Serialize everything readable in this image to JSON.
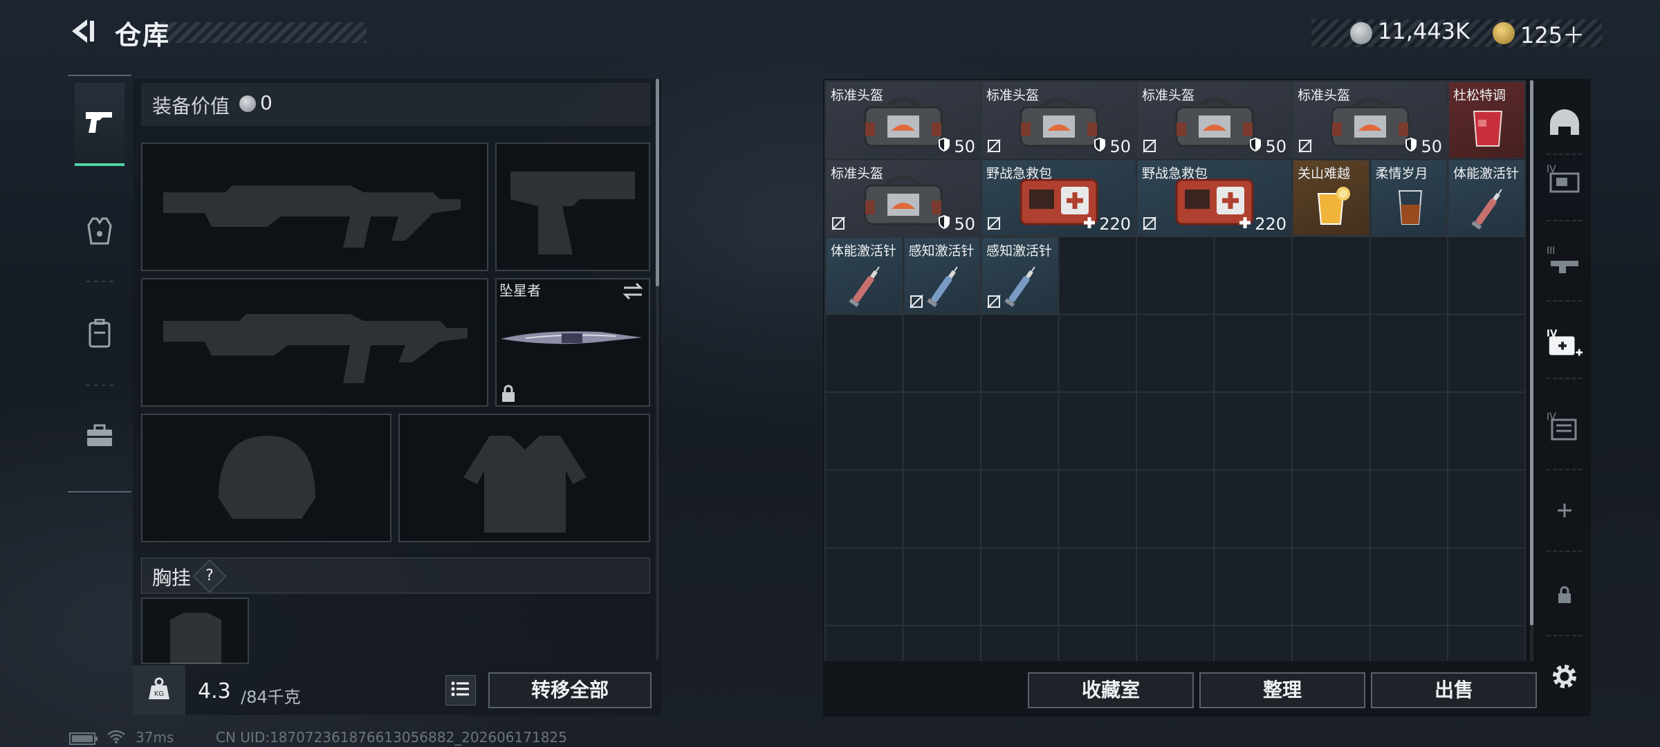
{
  "header": {
    "title": "仓库",
    "currency_silver": "11,443K",
    "currency_gold": "125＋"
  },
  "tabs": [
    {
      "name": "weapon",
      "icon": "pistol-icon",
      "active": true
    },
    {
      "name": "armor",
      "icon": "vest-icon",
      "active": false
    },
    {
      "name": "backpack",
      "icon": "backpack-icon",
      "active": false
    },
    {
      "name": "toolbox",
      "icon": "briefcase-icon",
      "active": false
    }
  ],
  "loadout": {
    "equipment_value_label": "装备价值",
    "equipment_value": "0",
    "melee_name": "坠星者",
    "chest_rig_label": "胸挂",
    "help_symbol": "?",
    "weight_current": "4.3",
    "weight_max": "/84千克",
    "transfer_all_label": "转移全部"
  },
  "warehouse": {
    "items": [
      {
        "name": "标准头盔",
        "count": "50",
        "count_icon": "shield",
        "style": "gray",
        "kind": "bag"
      },
      {
        "name": "标准头盔",
        "count": "50",
        "count_icon": "shield",
        "style": "gray",
        "kind": "bag"
      },
      {
        "name": "标准头盔",
        "count": "50",
        "count_icon": "shield",
        "style": "gray",
        "kind": "bag"
      },
      {
        "name": "标准头盔",
        "count": "50",
        "count_icon": "shield",
        "style": "gray",
        "kind": "bag"
      },
      {
        "name": "杜松特调",
        "count": "",
        "style": "red",
        "kind": "drink-red"
      },
      {
        "name": "标准头盔",
        "count": "50",
        "count_icon": "shield",
        "style": "gray",
        "kind": "bag"
      },
      {
        "name": "野战急救包",
        "count": "220",
        "count_icon": "plus",
        "style": "blue",
        "kind": "medkit"
      },
      {
        "name": "野战急救包",
        "count": "220",
        "count_icon": "plus",
        "style": "blue",
        "kind": "medkit"
      },
      {
        "name": "关山难越",
        "count": "",
        "style": "orange",
        "kind": "drink-yellow"
      },
      {
        "name": "柔情岁月",
        "count": "",
        "style": "blue",
        "kind": "drink-brown"
      },
      {
        "name": "体能激活针",
        "count": "",
        "style": "blue",
        "kind": "syringe-red"
      },
      {
        "name": "体能激活针",
        "count": "",
        "style": "blue",
        "kind": "syringe-red"
      },
      {
        "name": "感知激活针",
        "count": "",
        "style": "blue",
        "kind": "syringe-blue"
      },
      {
        "name": "感知激活针",
        "count": "",
        "style": "blue",
        "kind": "syringe-blue"
      }
    ],
    "buttons": {
      "collection": "收藏室",
      "sort": "整理",
      "sell": "出售"
    }
  },
  "side_rail": [
    {
      "icon": "helmet-icon"
    },
    {
      "icon": "case-iv-icon",
      "label": "IV"
    },
    {
      "icon": "case-iii-icon",
      "label": "III"
    },
    {
      "icon": "medkit-iv-icon",
      "label": "IV"
    },
    {
      "icon": "case-iv-2-icon",
      "label": "IV"
    },
    {
      "icon": "add-icon"
    },
    {
      "icon": "lock-icon"
    }
  ],
  "status_bar": {
    "ping": "37ms",
    "uid": "CN UID:18707236187661305688​2_202606171825"
  },
  "colors": {
    "accent_green": "#4fd3a4",
    "panel_bg": "#14191f"
  }
}
